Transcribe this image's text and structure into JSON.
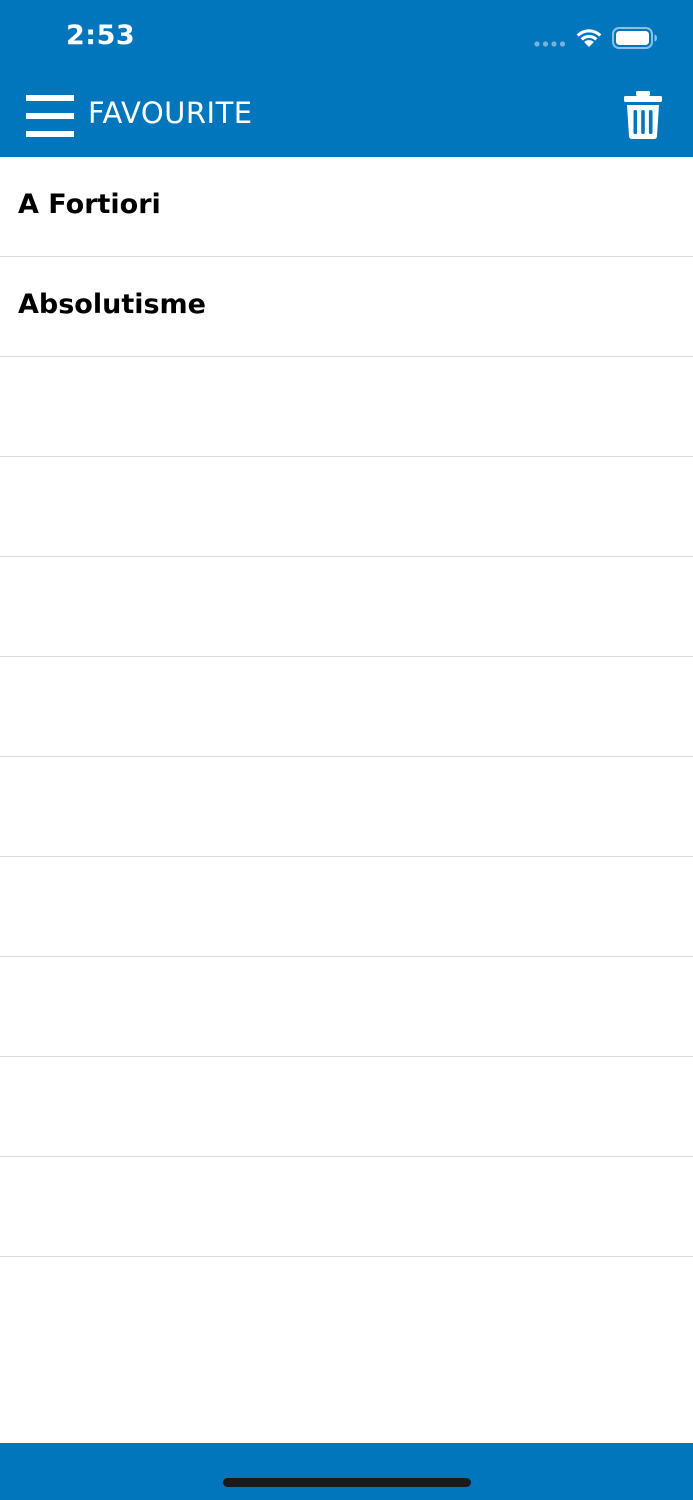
{
  "status_bar": {
    "time": "2:53"
  },
  "header": {
    "title": "FAVOURITE",
    "menu_icon": "hamburger-menu-icon",
    "action_icon": "trash-icon"
  },
  "favourites": {
    "items": [
      {
        "label": "A Fortiori"
      },
      {
        "label": "Absolutisme"
      },
      {
        "label": ""
      },
      {
        "label": ""
      },
      {
        "label": ""
      },
      {
        "label": ""
      },
      {
        "label": ""
      },
      {
        "label": ""
      },
      {
        "label": ""
      },
      {
        "label": ""
      },
      {
        "label": ""
      }
    ]
  },
  "colors": {
    "brand": "#0276bd",
    "divider": "#dcdcdc",
    "text": "#000000"
  }
}
